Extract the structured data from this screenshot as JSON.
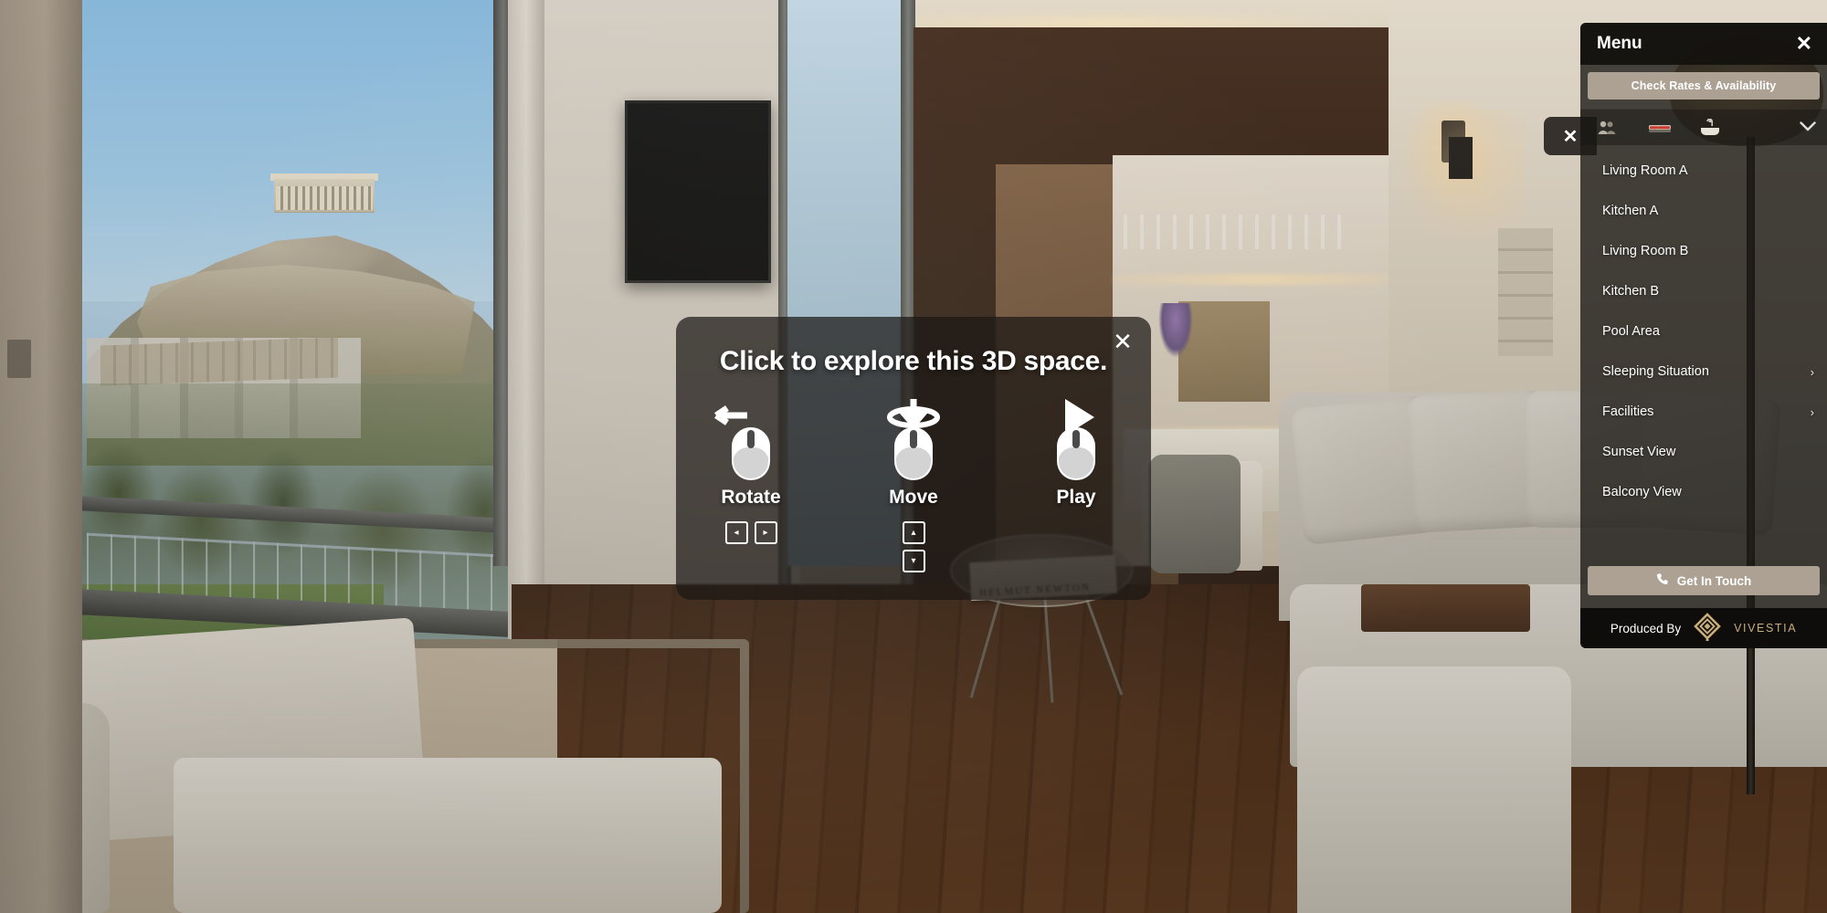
{
  "explore_overlay": {
    "title": "Click to explore this 3D space.",
    "close_icon": "close-icon",
    "close_glyph": "✕",
    "gestures": [
      {
        "label": "Rotate",
        "icon": "mouse-rotate-icon",
        "keys": [
          "◂",
          "▸"
        ],
        "keys_layout": "horizontal"
      },
      {
        "label": "Move",
        "icon": "mouse-move-icon",
        "keys": [
          "▴",
          "▾"
        ],
        "keys_layout": "vertical"
      },
      {
        "label": "Play",
        "icon": "mouse-play-icon",
        "keys": [],
        "keys_layout": "none"
      }
    ]
  },
  "menu": {
    "title": "Menu",
    "close_glyph": "✕",
    "check_rates_label": "Check Rates & Availability",
    "icon_row": {
      "guests_icon": "guests-icon",
      "bed_icon": "bed-icon",
      "bath_icon": "bathtub-icon",
      "expand_glyph": "˅"
    },
    "items": [
      {
        "label": "Living Room A",
        "has_submenu": false
      },
      {
        "label": "Kitchen A",
        "has_submenu": false
      },
      {
        "label": "Living Room B",
        "has_submenu": false
      },
      {
        "label": "Kitchen B",
        "has_submenu": false
      },
      {
        "label": "Pool Area",
        "has_submenu": false
      },
      {
        "label": "Sleeping Situation",
        "has_submenu": true
      },
      {
        "label": "Facilities",
        "has_submenu": true
      },
      {
        "label": "Sunset View",
        "has_submenu": false
      },
      {
        "label": "Balcony View",
        "has_submenu": false
      }
    ],
    "chevron_right_glyph": "›",
    "get_in_touch_label": "Get In Touch",
    "phone_icon": "phone-icon",
    "footer": {
      "produced_by_label": "Produced By",
      "brand_name": "VIVESTIA",
      "brand_logo_icon": "vivestia-diamond-logo"
    }
  },
  "side_close_tab": {
    "glyph": "✕",
    "icon": "close-icon"
  },
  "scene": {
    "book_title": "HELMUT NEWTON"
  },
  "colors": {
    "cta_background": "#ada193",
    "panel_background": "rgba(30,27,24,0.80)",
    "footer_background": "#0e0d0b",
    "brand_gold": "#c9ad7a",
    "overlay_background": "rgba(28,24,21,0.72)"
  }
}
